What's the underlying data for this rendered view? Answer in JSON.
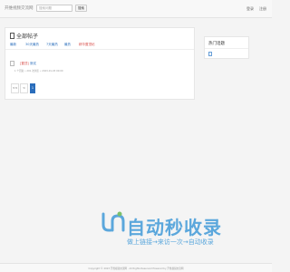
{
  "header": {
    "brand": "开维视频交流网",
    "search_placeholder": "搜索问题",
    "search_button": "搜索",
    "nav": [
      "登录",
      "注册"
    ]
  },
  "main": {
    "title": "全部帖子",
    "tabs": [
      "最新",
      "30天最热",
      "7天最热",
      "最热",
      "精华置顶帖"
    ],
    "posts": [
      {
        "tag": "[置顶]",
        "title": "测试",
        "meta": "1 个回复 • 201 次浏览 • 2023-01-03 00:00"
      }
    ],
    "pager": [
      "<<",
      "<",
      "1"
    ]
  },
  "sidebar": {
    "title": "热门话题"
  },
  "watermark": {
    "title": "自动秒收录",
    "subtitle": "做上链接→来访一次→自动收录"
  },
  "footer": {
    "text": "Copyright © 2023 开维视频交流网 · All Rights Reserved Powered by 开维视频交流网"
  },
  "colors": {
    "link": "#2a6dbb",
    "accent": "#d9534f",
    "watermark": "#5ba7dc"
  }
}
